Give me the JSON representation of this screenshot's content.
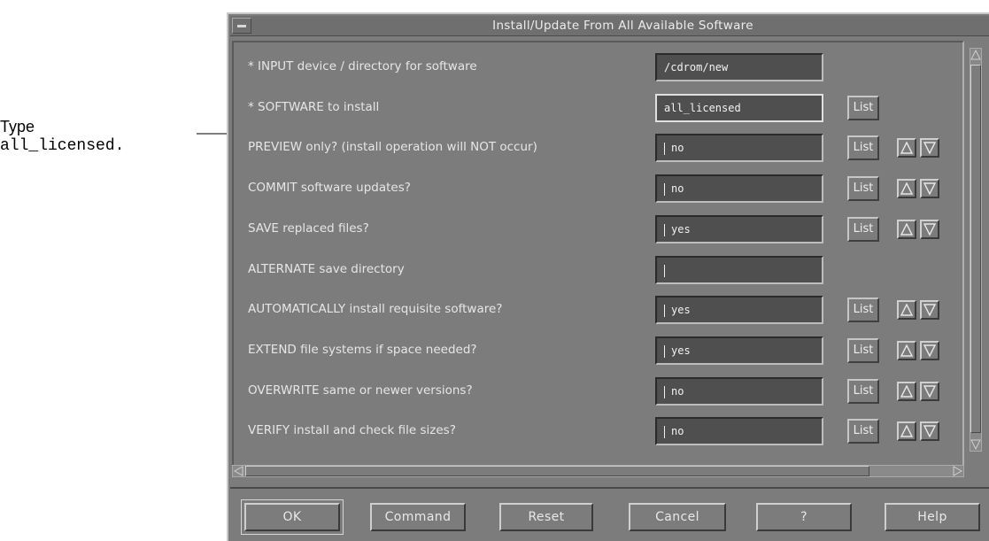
{
  "callout": {
    "line1": "Type",
    "line2": "all_licensed."
  },
  "window": {
    "title": "Install/Update From All Available Software"
  },
  "rows": [
    {
      "label": "* INPUT device / directory for software",
      "value": "/cdrom/new",
      "list": null,
      "cursor": false,
      "active": false,
      "spinner": false
    },
    {
      "label": "* SOFTWARE to install",
      "value": "all_licensed",
      "list": "List",
      "cursor": false,
      "active": true,
      "spinner": false
    },
    {
      "label": "PREVIEW only? (install operation will NOT occur)",
      "value": "no",
      "list": "List",
      "cursor": true,
      "active": false,
      "spinner": true
    },
    {
      "label": "COMMIT software updates?",
      "value": "no",
      "list": "List",
      "cursor": true,
      "active": false,
      "spinner": true
    },
    {
      "label": "SAVE replaced files?",
      "value": "yes",
      "list": "List",
      "cursor": true,
      "active": false,
      "spinner": true
    },
    {
      "label": "ALTERNATE save directory",
      "value": "",
      "list": null,
      "cursor": true,
      "active": false,
      "spinner": false
    },
    {
      "label": "AUTOMATICALLY install requisite software?",
      "value": "yes",
      "list": "List",
      "cursor": true,
      "active": false,
      "spinner": true
    },
    {
      "label": "EXTEND file systems if space needed?",
      "value": "yes",
      "list": "List",
      "cursor": true,
      "active": false,
      "spinner": true
    },
    {
      "label": "OVERWRITE same or newer versions?",
      "value": "no",
      "list": "List",
      "cursor": true,
      "active": false,
      "spinner": true
    },
    {
      "label": "VERIFY install and check file sizes?",
      "value": "no",
      "list": "List",
      "cursor": true,
      "active": false,
      "spinner": true
    }
  ],
  "buttons": {
    "ok": "OK",
    "command": "Command",
    "reset": "Reset",
    "cancel": "Cancel",
    "help_q": "?",
    "help": "Help"
  },
  "icons": {
    "up": "triangle-up-icon",
    "down": "triangle-down-icon"
  },
  "colors": {
    "window_bg": "#7c7c7c",
    "field_bg": "#4f4f4f",
    "text": "#e6e6e6"
  }
}
